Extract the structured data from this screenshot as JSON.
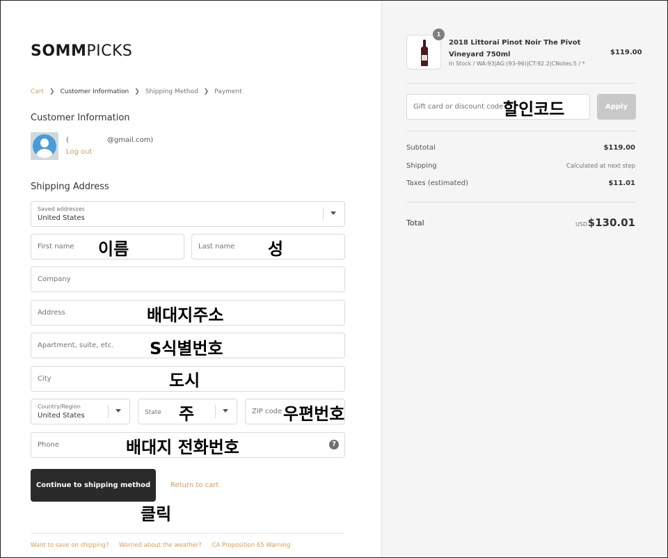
{
  "brand": {
    "logo_bold": "SOMM",
    "logo_light": "PICKS"
  },
  "breadcrumb": {
    "items": [
      "Cart",
      "Customer Information",
      "Shipping Method",
      "Payment"
    ],
    "current_index": 1
  },
  "customer": {
    "heading": "Customer Information",
    "name_paren": "(",
    "email": "@gmail.com)",
    "logout": "Log out"
  },
  "shipping": {
    "heading": "Shipping Address",
    "saved_label": "Saved addresses",
    "saved_value": "United States",
    "first_name_placeholder": "First name",
    "last_name_placeholder": "Last name",
    "company_placeholder": "Company",
    "address_placeholder": "Address",
    "apartment_placeholder": "Apartment, suite, etc.",
    "city_placeholder": "City",
    "country_label": "Country/Region",
    "country_value": "United States",
    "state_placeholder": "State",
    "zip_placeholder": "ZIP code",
    "phone_placeholder": "Phone",
    "help_glyph": "?"
  },
  "actions": {
    "continue": "Continue to shipping method",
    "return": "Return to cart"
  },
  "footer": {
    "links": [
      "Want to save on shipping?",
      "Worried about the weather?",
      "CA Proposition 65 Warning"
    ]
  },
  "annotations": {
    "first_name": "이름",
    "last_name": "성",
    "address": "배대지주소",
    "apartment": "S식별번호",
    "city": "도시",
    "state": "주",
    "zip": "우편번호",
    "phone": "배대지 전화번호",
    "click": "클릭",
    "discount": "할인코드"
  },
  "order": {
    "quantity": "1",
    "product_name": "2018 Littorai Pinot Noir The Pivot Vineyard 750ml",
    "product_meta": "In Stock / WA:93|AG:(93-96)|CT:92.2|CNotes:5 / *",
    "product_price": "$119.00",
    "discount_placeholder": "Gift card or discount code",
    "apply": "Apply",
    "subtotal_label": "Subtotal",
    "subtotal_value": "$119.00",
    "shipping_label": "Shipping",
    "shipping_value": "Calculated at next step",
    "taxes_label": "Taxes (estimated)",
    "taxes_value": "$11.01",
    "total_label": "Total",
    "currency": "USD",
    "total_value": "$130.01"
  },
  "colors": {
    "accent_link": "#d39c5c",
    "button_dark": "#2a2a2a",
    "apply_disabled": "#c8c8c8",
    "sidebar_bg": "#f5f5f5"
  }
}
